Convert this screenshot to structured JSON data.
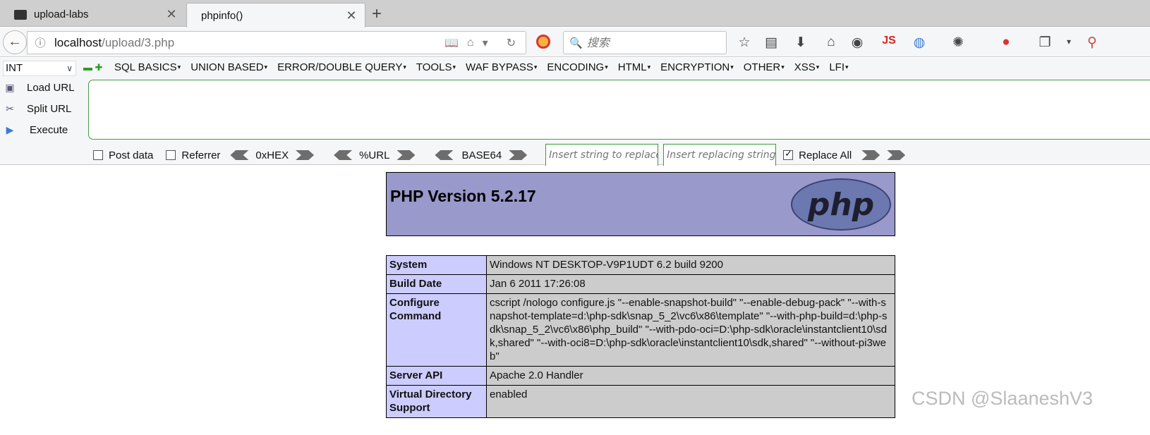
{
  "tabs": [
    {
      "title": "upload-labs",
      "active": false
    },
    {
      "title": "phpinfo()",
      "active": true
    }
  ],
  "navbar": {
    "url_host": "localhost",
    "url_path": "/upload/3.php",
    "search_placeholder": "搜索",
    "js_label": "JS"
  },
  "hackbar": {
    "type_select": "INT",
    "menus": [
      "SQL BASICS",
      "UNION BASED",
      "ERROR/DOUBLE QUERY",
      "TOOLS",
      "WAF BYPASS",
      "ENCODING",
      "HTML",
      "ENCRYPTION",
      "OTHER",
      "XSS",
      "LFI"
    ],
    "load_url": "Load URL",
    "split_url": "Split URL",
    "execute": "Execute",
    "url_value": "",
    "post_data": "Post data",
    "referrer": "Referrer",
    "hex": "0xHEX",
    "urlenc": "%URL",
    "base64": "BASE64",
    "replace_placeholder": "Insert string to replace",
    "replacing_placeholder": "Insert replacing string",
    "replace_all": "Replace All",
    "replace_all_checked": true
  },
  "phpinfo": {
    "title": "PHP Version 5.2.17",
    "logo": "php",
    "rows": [
      {
        "key": "System",
        "value": "Windows NT DESKTOP-V9P1UDT 6.2 build 9200"
      },
      {
        "key": "Build Date",
        "value": "Jan 6 2011 17:26:08"
      },
      {
        "key": "Configure Command",
        "value": "cscript /nologo configure.js \"--enable-snapshot-build\" \"--enable-debug-pack\" \"--with-snapshot-template=d:\\php-sdk\\snap_5_2\\vc6\\x86\\template\" \"--with-php-build=d:\\php-sdk\\snap_5_2\\vc6\\x86\\php_build\" \"--with-pdo-oci=D:\\php-sdk\\oracle\\instantclient10\\sdk,shared\" \"--with-oci8=D:\\php-sdk\\oracle\\instantclient10\\sdk,shared\" \"--without-pi3web\""
      },
      {
        "key": "Server API",
        "value": "Apache 2.0 Handler"
      },
      {
        "key": "Virtual Directory Support",
        "value": "enabled"
      }
    ]
  },
  "watermark": "CSDN @SlaaneshV3",
  "colors": {
    "php_header": "#9999cc",
    "key_cell": "#ccccff",
    "value_cell": "#cccccc",
    "hackbar_border": "#3a9a3a"
  }
}
